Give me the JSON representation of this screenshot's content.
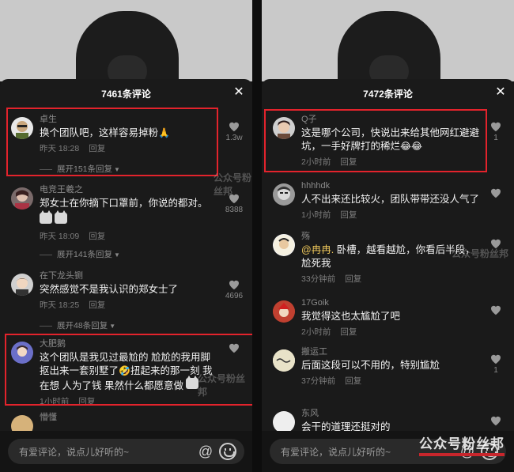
{
  "watermark_text": "公众号粉丝邦",
  "left": {
    "title": "7461条评论",
    "input_placeholder": "有爱评论，说点儿好听的~",
    "comments": [
      {
        "name": "卓生",
        "text": "换个团队吧，这样容易掉粉",
        "emoji": "🙏",
        "time": "昨天 18:28",
        "reply": "回复",
        "likes": "1.3w",
        "expand": "展开151条回复"
      },
      {
        "name": "电竞王羲之",
        "text": "郑女士在你摘下口罩前，你说的都对。",
        "time": "昨天 18:09",
        "reply": "回复",
        "likes": "8388",
        "expand": "展开141条回复"
      },
      {
        "name": "在下龙头铡",
        "text": "突然感觉不是我认识的郑女士了",
        "time": "昨天 18:25",
        "reply": "回复",
        "likes": "4696",
        "expand": "展开48条回复"
      },
      {
        "name": "大肥鹅",
        "text": "这个团队是我见过最尬的 尬尬的我用脚抠出来一套别墅了",
        "emoji": "🤣",
        "text2": "扭起来的那一刻 我在想 人为了钱 果然什么都愿意做",
        "time": "1小时前",
        "reply": "回复"
      },
      {
        "name": "懵懂"
      }
    ]
  },
  "right": {
    "title": "7472条评论",
    "input_placeholder": "有爱评论，说点儿好听的~",
    "comments": [
      {
        "name": "Q子",
        "text": "这是哪个公司，快说出来给其他网红避避坑，一手好牌打的稀烂",
        "emoji": "😂😂",
        "time": "2小时前",
        "reply": "回复",
        "likes": "1"
      },
      {
        "name": "hhhhdk",
        "text": "人不出来还比较火，团队带带还没人气了",
        "time": "1小时前",
        "reply": "回复"
      },
      {
        "name": "殇",
        "mention": "@冉冉.",
        "text": "卧槽，越看越尬，你看后半段，尬死我",
        "time": "33分钟前",
        "reply": "回复"
      },
      {
        "name": "17Goik",
        "text": "我觉得这也太尴尬了吧",
        "time": "2小时前",
        "reply": "回复"
      },
      {
        "name": "搬运工",
        "text": "后面这段可以不用的，特别尴尬",
        "time": "37分钟前",
        "reply": "回复",
        "likes": "1"
      },
      {
        "name": "东风",
        "text": "会干的道理还挺对的"
      }
    ]
  }
}
